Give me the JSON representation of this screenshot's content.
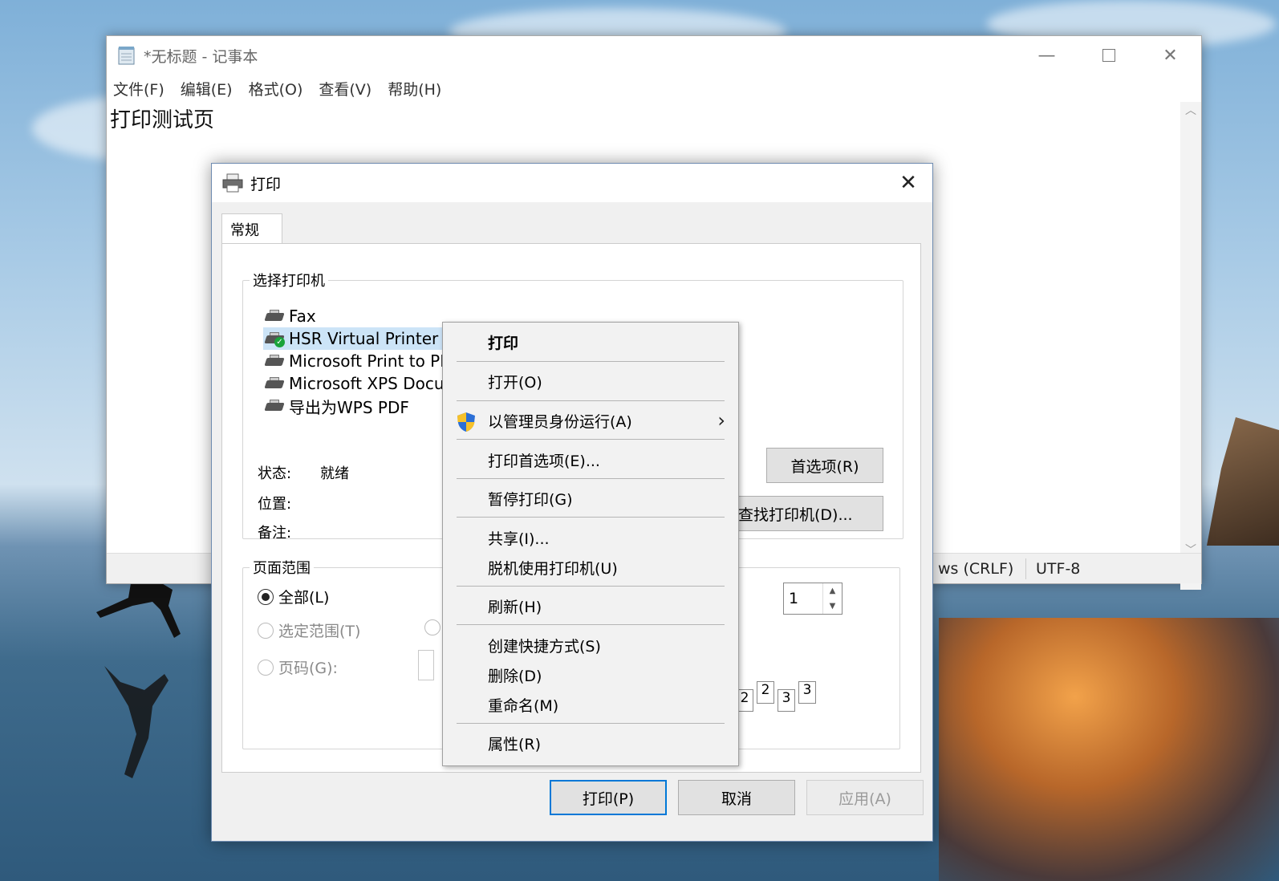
{
  "notepad": {
    "title": "*无标题 - 记事本",
    "menus": [
      "文件(F)",
      "编辑(E)",
      "格式(O)",
      "查看(V)",
      "帮助(H)"
    ],
    "content": "打印测试页",
    "status": {
      "line_ending": "ws (CRLF)",
      "encoding": "UTF-8"
    }
  },
  "print_dialog": {
    "title": "打印",
    "tab": "常规",
    "select_printer_label": "选择打印机",
    "printers": [
      "Fax",
      "HSR Virtual Printer",
      "Microsoft Print to PD",
      "Microsoft XPS Docu",
      "导出为WPS PDF"
    ],
    "selected_printer_index": 1,
    "status_label": "状态:",
    "status_value": "就绪",
    "location_label": "位置:",
    "comment_label": "备注:",
    "preferences_button": "首选项(R)",
    "find_printer_button": "查找打印机(D)...",
    "page_range_label": "页面范围",
    "radio_all": "全部(L)",
    "radio_selection": "选定范围(T)",
    "radio_pages": "页码(G):",
    "copies_value": "1",
    "paren_fragment": ")",
    "collate_pages": [
      "2",
      "2",
      "3",
      "3"
    ],
    "print_button": "打印(P)",
    "cancel_button": "取消",
    "apply_button": "应用(A)"
  },
  "context_menu": {
    "items": {
      "print": "打印",
      "open": "打开(O)",
      "run_as_admin": "以管理员身份运行(A)",
      "print_preferences": "打印首选项(E)...",
      "pause": "暂停打印(G)",
      "share": "共享(I)...",
      "offline": "脱机使用打印机(U)",
      "refresh": "刷新(H)",
      "create_shortcut": "创建快捷方式(S)",
      "delete": "删除(D)",
      "rename": "重命名(M)",
      "properties": "属性(R)"
    }
  },
  "colors": {
    "selection": "#cce4f7",
    "accent": "#0078d7",
    "shield_blue": "#2b6fd6",
    "shield_yellow": "#f6c12b"
  }
}
